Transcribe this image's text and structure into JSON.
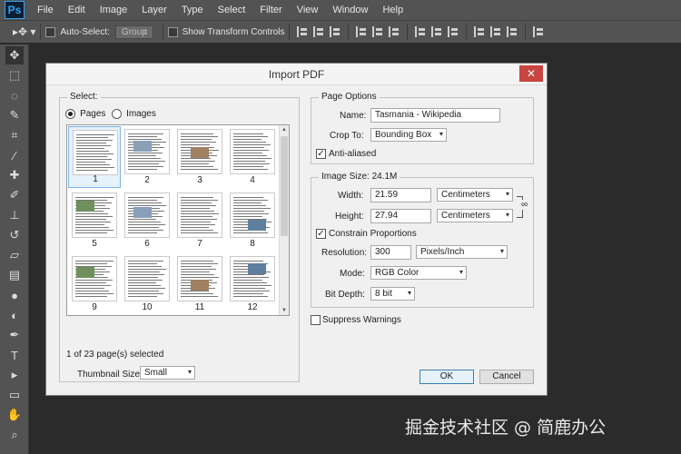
{
  "app": {
    "logo": "Ps"
  },
  "menu": [
    "File",
    "Edit",
    "Image",
    "Layer",
    "Type",
    "Select",
    "Filter",
    "View",
    "Window",
    "Help"
  ],
  "options_bar": {
    "auto_select_label": "Auto-Select:",
    "auto_select_value": "Group",
    "transform_label": "Show Transform Controls"
  },
  "tools": [
    "move-tool-icon",
    "marquee-tool-icon",
    "lasso-tool-icon",
    "quick-select-tool-icon",
    "crop-tool-icon",
    "eyedropper-tool-icon",
    "healing-brush-icon",
    "brush-tool-icon",
    "clone-stamp-icon",
    "history-brush-icon",
    "eraser-tool-icon",
    "gradient-tool-icon",
    "blur-tool-icon",
    "dodge-tool-icon",
    "pen-tool-icon",
    "type-tool-icon",
    "path-select-icon",
    "shape-tool-icon",
    "hand-tool-icon",
    "zoom-tool-icon"
  ],
  "dialog": {
    "title": "Import PDF",
    "close": "✕",
    "select": {
      "legend": "Select:",
      "pages_label": "Pages",
      "images_label": "Images",
      "mode": "pages",
      "thumbnails": [
        "1",
        "2",
        "3",
        "4",
        "5",
        "6",
        "7",
        "8",
        "9",
        "10",
        "11",
        "12"
      ],
      "selected_index": 0,
      "status": "1 of 23 page(s) selected",
      "thumb_size_label": "Thumbnail Size:",
      "thumb_size_value": "Small"
    },
    "page_options": {
      "legend": "Page Options",
      "name_label": "Name:",
      "name_value": "Tasmania - Wikipedia",
      "crop_label": "Crop To:",
      "crop_value": "Bounding Box",
      "anti_aliased_label": "Anti-aliased",
      "anti_aliased_checked": true
    },
    "image_size": {
      "legend": "Image Size: 24.1M",
      "width_label": "Width:",
      "width_value": "21.59",
      "width_unit": "Centimeters",
      "height_label": "Height:",
      "height_value": "27.94",
      "height_unit": "Centimeters",
      "constrain_label": "Constrain Proportions",
      "constrain_checked": true,
      "resolution_label": "Resolution:",
      "resolution_value": "300",
      "resolution_unit": "Pixels/Inch",
      "mode_label": "Mode:",
      "mode_value": "RGB Color",
      "bit_depth_label": "Bit Depth:",
      "bit_depth_value": "8 bit"
    },
    "suppress_label": "Suppress Warnings",
    "suppress_checked": false,
    "ok_label": "OK",
    "cancel_label": "Cancel"
  },
  "watermark": "掘金技术社区 @ 简鹿办公"
}
